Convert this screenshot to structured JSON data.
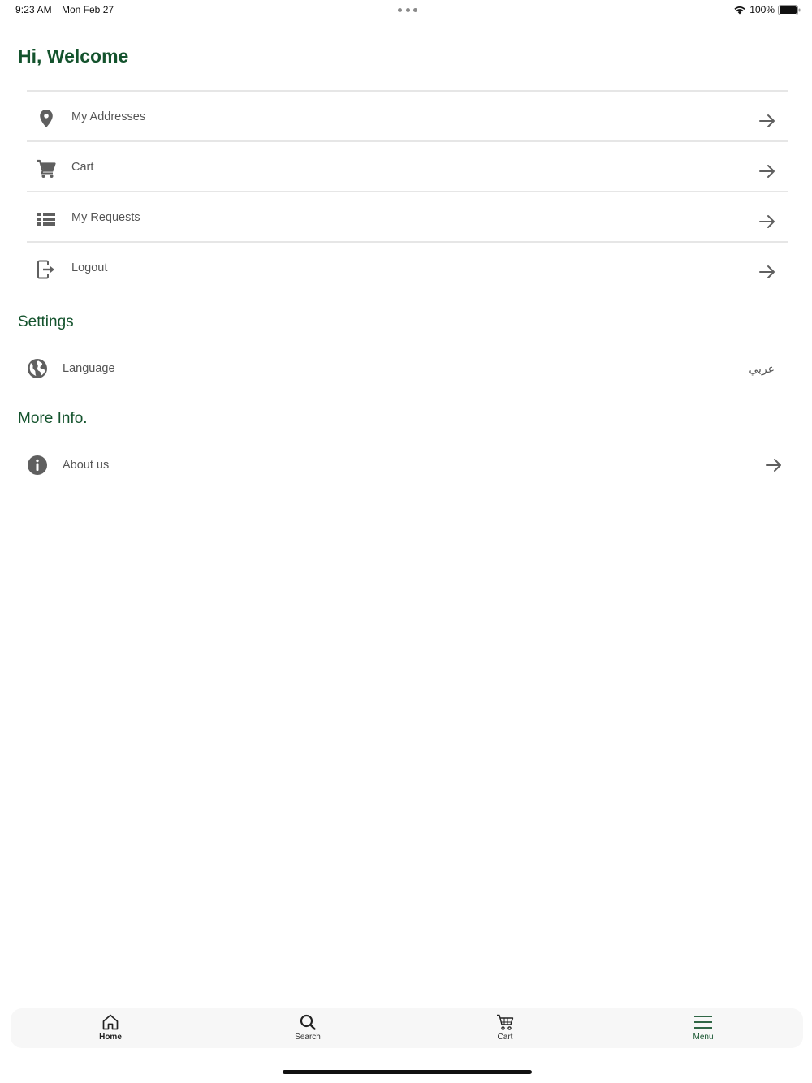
{
  "status_bar": {
    "time": "9:23 AM",
    "date": "Mon Feb 27",
    "battery": "100%"
  },
  "header": {
    "title": "Hi, Welcome"
  },
  "menu": {
    "items": [
      {
        "label": "My Addresses",
        "icon": "location-pin-icon"
      },
      {
        "label": "Cart",
        "icon": "cart-icon"
      },
      {
        "label": "My Requests",
        "icon": "list-icon"
      },
      {
        "label": "Logout",
        "icon": "logout-icon"
      }
    ]
  },
  "settings": {
    "title": "Settings",
    "language_label": "Language",
    "language_value": "عربي"
  },
  "more_info": {
    "title": "More Info.",
    "about_label": "About us"
  },
  "tab_bar": {
    "tabs": [
      {
        "label": "Home",
        "icon": "home-icon"
      },
      {
        "label": "Search",
        "icon": "search-icon"
      },
      {
        "label": "Cart",
        "icon": "cart-icon"
      },
      {
        "label": "Menu",
        "icon": "menu-icon",
        "active": true
      }
    ]
  },
  "colors": {
    "brand_green": "#14532d",
    "icon_gray": "#5f5f5f",
    "divider": "#e6e6e6"
  }
}
